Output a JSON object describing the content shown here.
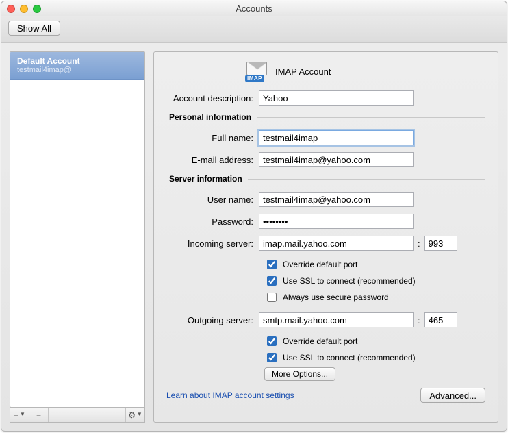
{
  "window": {
    "title": "Accounts"
  },
  "toolbar": {
    "show_all": "Show All"
  },
  "sidebar": {
    "account": {
      "title": "Default Account",
      "email": "testmail4imap@"
    },
    "buttons": {
      "add": "+",
      "remove": "−",
      "gear": "⚙"
    }
  },
  "header": {
    "icon_label": "IMAP Account",
    "imap_badge": "IMAP"
  },
  "labels": {
    "description": "Account description:",
    "personal_section": "Personal information",
    "full_name": "Full name:",
    "email": "E-mail address:",
    "server_section": "Server information",
    "user_name": "User name:",
    "password": "Password:",
    "incoming": "Incoming server:",
    "outgoing": "Outgoing server:",
    "override_port": "Override default port",
    "use_ssl": "Use SSL to connect (recommended)",
    "secure_pw": "Always use secure password",
    "more_options": "More Options...",
    "learn_link": "Learn about IMAP account settings",
    "advanced": "Advanced...",
    "colon": ":"
  },
  "values": {
    "description": "Yahoo",
    "full_name": "testmail4imap",
    "email": "testmail4imap@yahoo.com",
    "user_name": "testmail4imap@yahoo.com",
    "password": "••••••••",
    "incoming_server": "imap.mail.yahoo.com",
    "incoming_port": "993",
    "outgoing_server": "smtp.mail.yahoo.com",
    "outgoing_port": "465"
  },
  "checks": {
    "in_override": true,
    "in_ssl": true,
    "in_secure": false,
    "out_override": true,
    "out_ssl": true
  }
}
